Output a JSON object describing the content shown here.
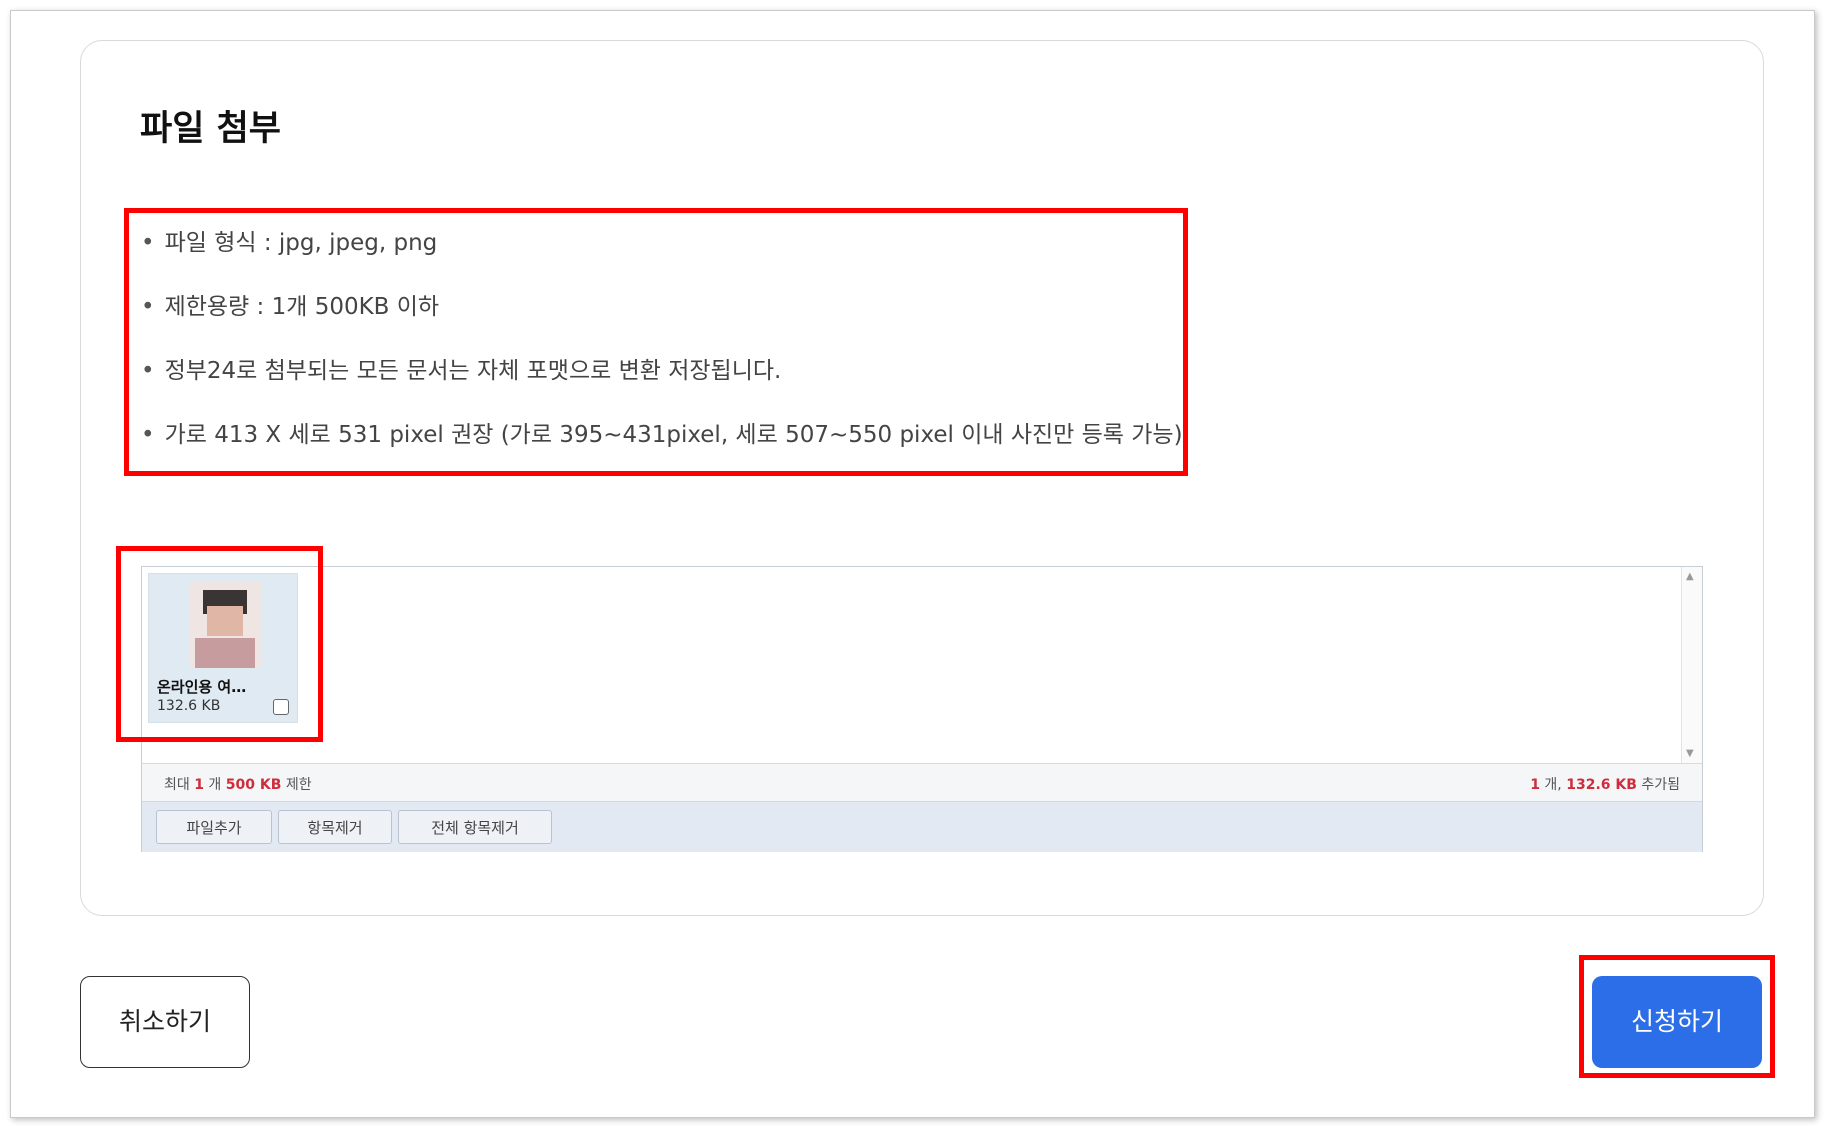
{
  "section": {
    "title": "파일 첨부"
  },
  "guide": {
    "items": [
      "파일 형식 : jpg, jpeg, png",
      "제한용량 : 1개 500KB 이하",
      "정부24로 첨부되는 모든 문서는 자체 포맷으로 변환 저장됩니다.",
      "가로 413 X 세로 531 pixel 권장 (가로 395~431pixel, 세로 507~550 pixel 이내 사진만 등록 가능)"
    ]
  },
  "uploader": {
    "file": {
      "name": "온라인용 여…",
      "size": "132.6 KB",
      "checked": false
    },
    "limit": {
      "prefix": "최대",
      "count": "1",
      "count_unit": "개",
      "size": "500 KB",
      "suffix": "제한"
    },
    "status": {
      "count": "1",
      "count_unit": "개,",
      "size": "132.6 KB",
      "suffix": "추가됨"
    },
    "buttons": {
      "add": "파일추가",
      "remove": "항목제거",
      "remove_all": "전체 항목제거"
    }
  },
  "actions": {
    "cancel": "취소하기",
    "submit": "신청하기"
  },
  "colors": {
    "highlight": "#ff0000",
    "primary": "#2c6ee8",
    "limit_text": "#d02c3c"
  }
}
